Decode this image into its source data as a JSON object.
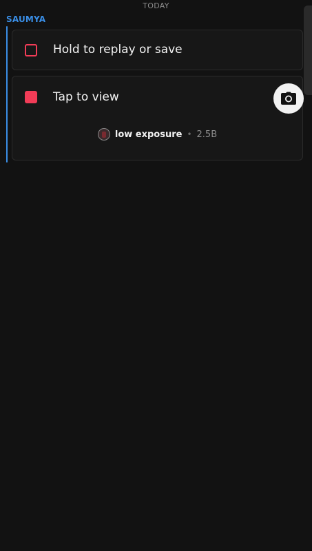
{
  "date_header": "TODAY",
  "conversation": {
    "sender": "SAUMYA",
    "messages": [
      {
        "text": "Hold to replay or save",
        "icon": "snap-outline-icon",
        "status": "opened"
      },
      {
        "text": "Tap to view",
        "icon": "snap-filled-icon",
        "status": "unopened",
        "action_icon": "camera-icon",
        "source": {
          "name": "low exposure",
          "separator": "•",
          "views": "2.5B"
        }
      }
    ]
  },
  "colors": {
    "background": "#121212",
    "card": "#171717",
    "accent_blue": "#3a8ee6",
    "snap_red": "#f23c57"
  }
}
